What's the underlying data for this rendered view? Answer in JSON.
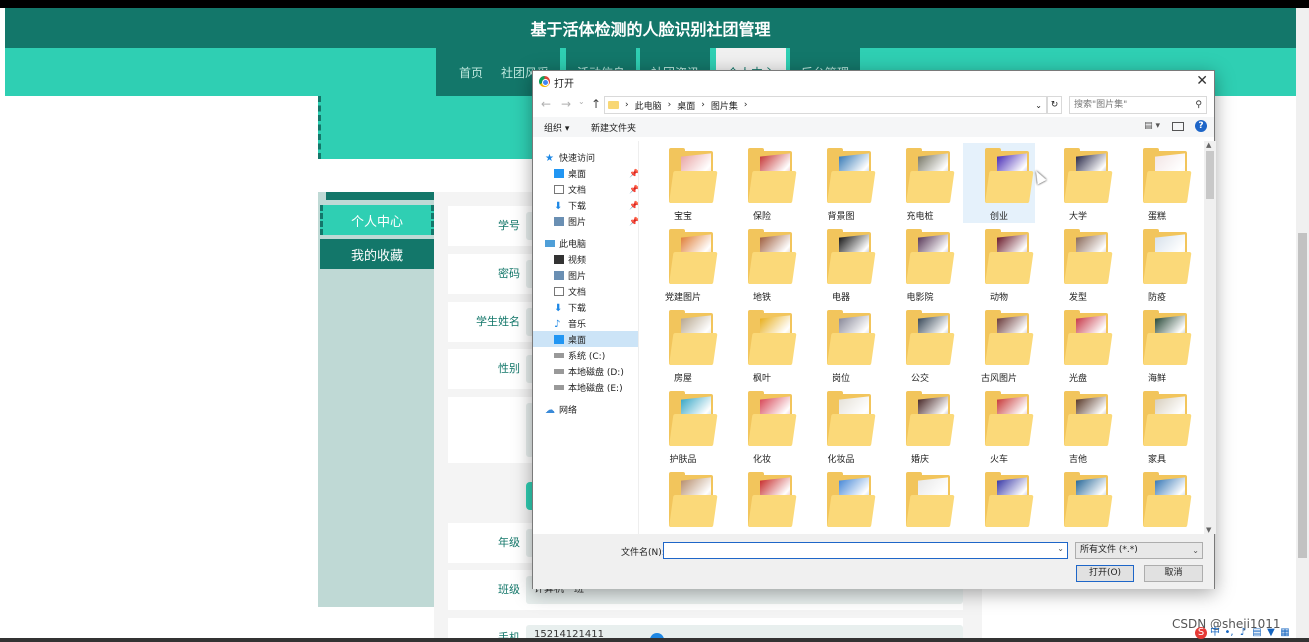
{
  "site": {
    "title": "基于活体检测的人脸识别社团管理",
    "nav": [
      "首页",
      "社团风采",
      "活动信息",
      "社团资讯",
      "个人中心",
      "后台管理"
    ],
    "active_nav": "个人中心"
  },
  "sidebar": {
    "items": [
      {
        "label": "个人中心"
      },
      {
        "label": "我的收藏"
      }
    ]
  },
  "form": {
    "rows": [
      {
        "label": "学号",
        "value": ""
      },
      {
        "label": "密码",
        "value": ""
      },
      {
        "label": "学生姓名",
        "value": ""
      },
      {
        "label": "性别",
        "value": ""
      },
      {
        "label": "年级",
        "value": ""
      },
      {
        "label": "班级",
        "value": "计算机一班"
      },
      {
        "label": "手机",
        "value": "15214121411"
      }
    ]
  },
  "dialog": {
    "title": "打开",
    "breadcrumb": [
      "此电脑",
      "桌面",
      "图片集"
    ],
    "search_placeholder": "搜索\"图片集\"",
    "toolbar": {
      "organize": "组织 ▾",
      "new_folder": "新建文件夹",
      "help": "?"
    },
    "nav_pane": [
      {
        "label": "快速访问",
        "icon": "star-icon",
        "pinned": false
      },
      {
        "label": "桌面",
        "icon": "desktop-icon",
        "pinned": true
      },
      {
        "label": "文档",
        "icon": "document-icon",
        "pinned": true
      },
      {
        "label": "下载",
        "icon": "download-icon",
        "pinned": true
      },
      {
        "label": "图片",
        "icon": "picture-icon",
        "pinned": true
      },
      {
        "label": "此电脑",
        "icon": "computer-icon",
        "pinned": false
      },
      {
        "label": "视频",
        "icon": "video-icon",
        "pinned": false
      },
      {
        "label": "图片",
        "icon": "picture-icon",
        "pinned": false
      },
      {
        "label": "文档",
        "icon": "document-icon",
        "pinned": false
      },
      {
        "label": "下载",
        "icon": "download-icon",
        "pinned": false
      },
      {
        "label": "音乐",
        "icon": "music-icon",
        "pinned": false
      },
      {
        "label": "桌面",
        "icon": "desktop-icon",
        "pinned": false
      },
      {
        "label": "系统 (C:)",
        "icon": "drive-icon",
        "pinned": false
      },
      {
        "label": "本地磁盘 (D:)",
        "icon": "drive-icon",
        "pinned": false
      },
      {
        "label": "本地磁盘 (E:)",
        "icon": "drive-icon",
        "pinned": false
      },
      {
        "label": "网络",
        "icon": "network-icon",
        "pinned": false
      }
    ],
    "selected_nav": "桌面",
    "folders": [
      {
        "name": "宝宝",
        "color": "#e9a7a7"
      },
      {
        "name": "保险",
        "color": "#c73b3b"
      },
      {
        "name": "背景图",
        "color": "#3b7db8"
      },
      {
        "name": "充电桩",
        "color": "#7a7a6a"
      },
      {
        "name": "创业",
        "color": "#4a2fb8"
      },
      {
        "name": "大学",
        "color": "#2b2b4a"
      },
      {
        "name": "蛋糕",
        "color": "#f3e6e6"
      },
      {
        "name": "党建图片",
        "color": "#e0803a"
      },
      {
        "name": "地铁",
        "color": "#a06040"
      },
      {
        "name": "电器",
        "color": "#1a1a1a"
      },
      {
        "name": "电影院",
        "color": "#5a3a5a"
      },
      {
        "name": "动物",
        "color": "#6a1a2a"
      },
      {
        "name": "发型",
        "color": "#8a6a5a"
      },
      {
        "name": "防疫",
        "color": "#d8e2ec"
      },
      {
        "name": "房屋",
        "color": "#b8a890"
      },
      {
        "name": "枫叶",
        "color": "#e8b020"
      },
      {
        "name": "岗位",
        "color": "#8a8a9a"
      },
      {
        "name": "公交",
        "color": "#3a4a5a"
      },
      {
        "name": "古风图片",
        "color": "#6a3a3a"
      },
      {
        "name": "光盘",
        "color": "#c83a4a"
      },
      {
        "name": "海鲜",
        "color": "#2a4a3a"
      },
      {
        "name": "护肤品",
        "color": "#3aa8c8"
      },
      {
        "name": "化妆",
        "color": "#d84a5a"
      },
      {
        "name": "化妆品",
        "color": "#e6e2da"
      },
      {
        "name": "婚庆",
        "color": "#4a2a2a"
      },
      {
        "name": "火车",
        "color": "#c83a3a"
      },
      {
        "name": "吉他",
        "color": "#5a3a2a"
      },
      {
        "name": "家具",
        "color": "#d8d0c0"
      },
      {
        "name": "",
        "color": "#b89070"
      },
      {
        "name": "",
        "color": "#c83030"
      },
      {
        "name": "",
        "color": "#4a8ad8"
      },
      {
        "name": "",
        "color": "#e8e8e8"
      },
      {
        "name": "",
        "color": "#3a3aa8"
      },
      {
        "name": "",
        "color": "#2a6a9a"
      },
      {
        "name": "",
        "color": "#3a7ab8"
      }
    ],
    "selected_folder": "创业",
    "filename_label": "文件名(N):",
    "filename_value": "",
    "filetype": "所有文件 (*.*)",
    "open_label": "打开(O)",
    "cancel_label": "取消"
  },
  "watermark": "CSDN @sheji1011",
  "colors": {
    "primary": "#13776a",
    "accent": "#2fcfb3",
    "dialog_blue": "#1e66c8"
  }
}
